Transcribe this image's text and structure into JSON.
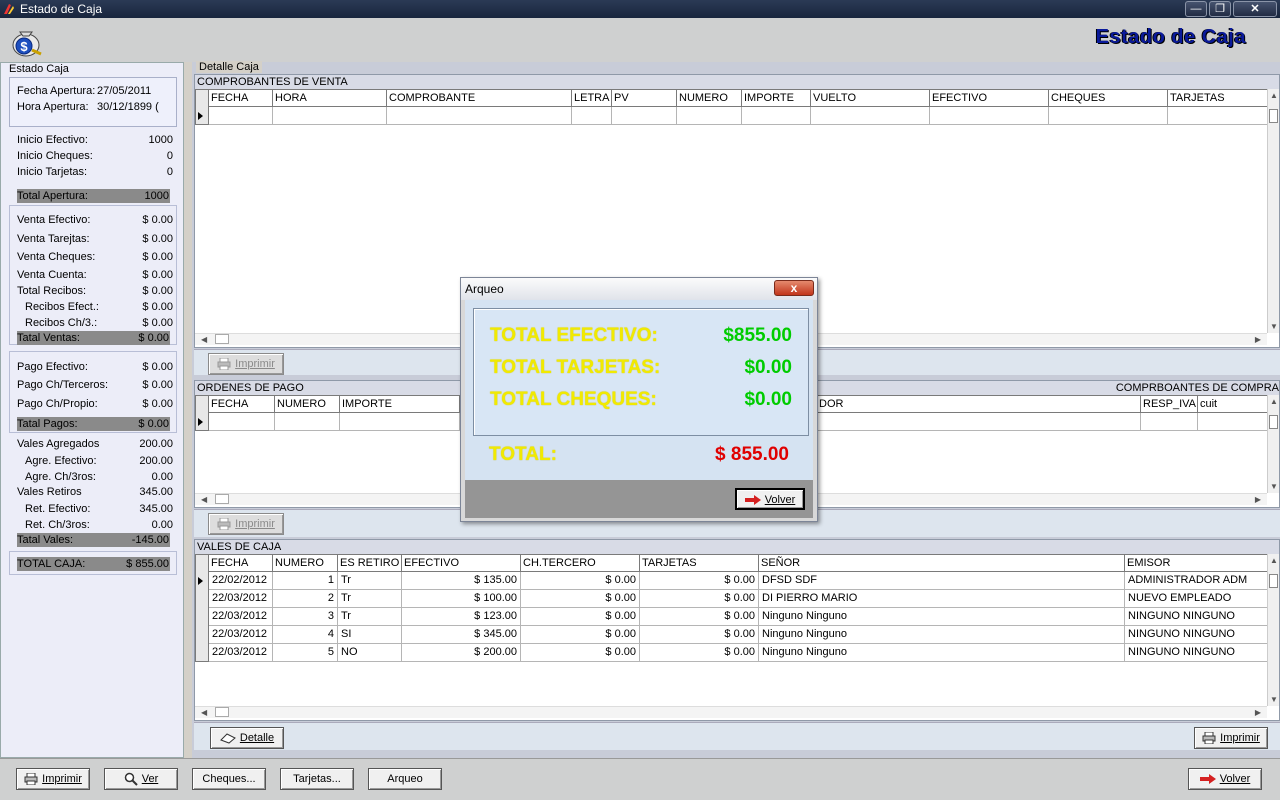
{
  "window": {
    "title": "Estado de Caja",
    "header_title": "Estado de Caja"
  },
  "left": {
    "caption": "Estado Caja",
    "fecha_apertura": {
      "label": "Fecha Apertura:",
      "value": "27/05/2011"
    },
    "hora_apertura": {
      "label": "Hora Apertura:",
      "value": "30/12/1899 ("
    },
    "inicio": [
      {
        "label": "Inicio Efectivo:",
        "value": "1000"
      },
      {
        "label": "Inicio Cheques:",
        "value": "0"
      },
      {
        "label": "Inicio Tarjetas:",
        "value": "0"
      }
    ],
    "total_apertura": {
      "label": "Total Apertura:",
      "value": "1000"
    },
    "ventas": [
      {
        "label": "Venta Efectivo:",
        "value": "$ 0.00"
      },
      {
        "label": "Venta Tarejtas:",
        "value": "$ 0.00"
      },
      {
        "label": "Venta Cheques:",
        "value": "$ 0.00"
      },
      {
        "label": "Venta Cuenta:",
        "value": "$ 0.00"
      },
      {
        "label": "Total Recibos:",
        "value": "$ 0.00"
      },
      {
        "label": "Recibos Efect.:",
        "value": "$ 0.00"
      },
      {
        "label": "Recibos Ch/3.:",
        "value": "$ 0.00"
      }
    ],
    "total_ventas": {
      "label": "Tatal Ventas:",
      "value": "$ 0.00"
    },
    "pagos": [
      {
        "label": "Pago Efectivo:",
        "value": "$ 0.00"
      },
      {
        "label": "Pago Ch/Terceros:",
        "value": "$ 0.00"
      },
      {
        "label": "Pago Ch/Propio:",
        "value": "$ 0.00"
      }
    ],
    "total_pagos": {
      "label": "Tatal Pagos:",
      "value": "$ 0.00"
    },
    "vales": [
      {
        "label": "Vales Agregados",
        "value": "200.00"
      },
      {
        "label": "Agre. Efectivo:",
        "value": "200.00"
      },
      {
        "label": "Agre. Ch/3ros:",
        "value": "0.00"
      },
      {
        "label": "Vales Retiros",
        "value": "345.00"
      },
      {
        "label": "Ret. Efectivo:",
        "value": "345.00"
      },
      {
        "label": "Ret. Ch/3ros:",
        "value": "0.00"
      }
    ],
    "total_vales": {
      "label": "Tatal Vales:",
      "value": "-145.00"
    },
    "total_caja": {
      "label": "TOTAL CAJA:",
      "value": "$ 855.00"
    }
  },
  "main": {
    "caption": "Detalle Caja",
    "ventas": {
      "title": "COMPROBANTES DE VENTA",
      "columns": [
        "FECHA",
        "HORA",
        "COMPROBANTE",
        "LETRA",
        "PV",
        "NUMERO",
        "IMPORTE",
        "VUELTO",
        "EFECTIVO",
        "CHEQUES",
        "TARJETAS"
      ]
    },
    "imprimir": "Imprimir",
    "ordenes": {
      "title": "ORDENES DE PAGO",
      "title_right": "COMPRBOANTES DE COMPRA",
      "columns": [
        "FECHA",
        "NUMERO",
        "IMPORTE"
      ],
      "columns_right": [
        "DOR",
        "RESP_IVA",
        "cuit"
      ]
    },
    "vales": {
      "title": "VALES DE CAJA",
      "columns": [
        "FECHA",
        "NUMERO",
        "ES RETIRO",
        "EFECTIVO",
        "CH.TERCERO",
        "TARJETAS",
        "SEÑOR",
        "EMISOR"
      ],
      "rows": [
        [
          "22/02/2012",
          "1",
          "Tr",
          "$ 135.00",
          "$ 0.00",
          "$ 0.00",
          "DFSD SDF",
          "ADMINISTRADOR ADM"
        ],
        [
          "22/03/2012",
          "2",
          "Tr",
          "$ 100.00",
          "$ 0.00",
          "$ 0.00",
          "DI PIERRO MARIO",
          "NUEVO EMPLEADO"
        ],
        [
          "22/03/2012",
          "3",
          "Tr",
          "$ 123.00",
          "$ 0.00",
          "$ 0.00",
          "Ninguno Ninguno",
          "NINGUNO NINGUNO"
        ],
        [
          "22/03/2012",
          "4",
          "SI",
          "$ 345.00",
          "$ 0.00",
          "$ 0.00",
          "Ninguno Ninguno",
          "NINGUNO NINGUNO"
        ],
        [
          "22/03/2012",
          "5",
          "NO",
          "$ 200.00",
          "$ 0.00",
          "$ 0.00",
          "Ninguno Ninguno",
          "NINGUNO NINGUNO"
        ]
      ],
      "detalle": "Detalle",
      "imprimir": "Imprimir"
    }
  },
  "bottom": {
    "imprimir": "Imprimir",
    "ver": "Ver",
    "cheques": "Cheques...",
    "tarjetas": "Tarjetas...",
    "arqueo": "Arqueo",
    "volver": "Volver"
  },
  "dialog": {
    "title": "Arqueo",
    "close": "x",
    "efectivo": {
      "label": "TOTAL EFECTIVO:",
      "value": "$855.00"
    },
    "tarjetas": {
      "label": "TOTAL TARJETAS:",
      "value": "$0.00"
    },
    "cheques": {
      "label": "TOTAL CHEQUES:",
      "value": "$0.00"
    },
    "total": {
      "label": "TOTAL:",
      "value": "$ 855.00"
    },
    "volver": "Volver"
  },
  "colors": {
    "dialog_label": "#f1ea00",
    "dialog_value": "#00cc00",
    "dialog_total": "#e00000",
    "header_title": "#0a1a9a"
  }
}
